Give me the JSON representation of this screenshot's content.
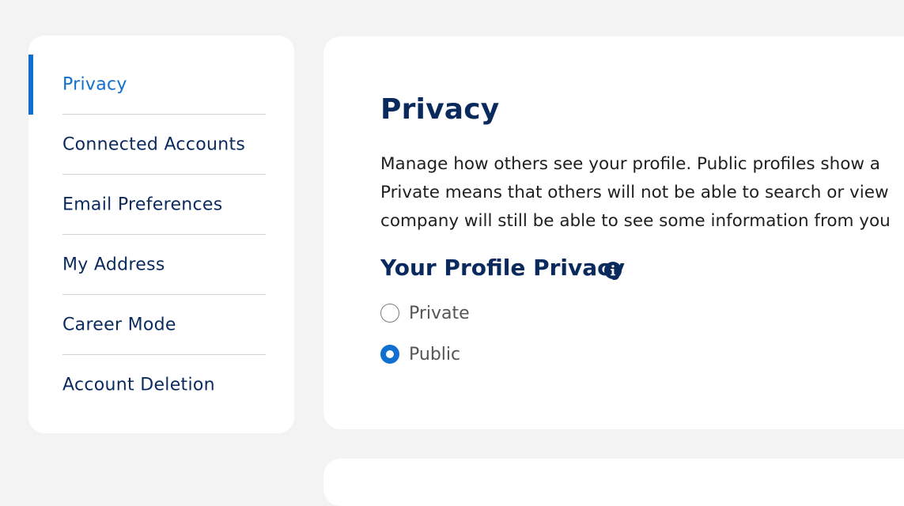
{
  "sidebar": {
    "items": [
      {
        "label": "Privacy",
        "active": true
      },
      {
        "label": "Connected Accounts",
        "active": false
      },
      {
        "label": "Email Preferences",
        "active": false
      },
      {
        "label": "My Address",
        "active": false
      },
      {
        "label": "Career Mode",
        "active": false
      },
      {
        "label": "Account Deletion",
        "active": false
      }
    ]
  },
  "main": {
    "title": "Privacy",
    "description_lines": [
      "Manage how others see your profile. Public profiles show a",
      "Private means that others will not be able to search or view",
      "company will still be able to see some information from you"
    ],
    "section_title": "Your Profile Privacy",
    "info_icon": "info-icon",
    "options": [
      {
        "label": "Private",
        "selected": false
      },
      {
        "label": "Public",
        "selected": true
      }
    ]
  },
  "colors": {
    "accent": "#1170cf",
    "heading": "#0a2a5e",
    "background": "#f3f3f3",
    "card": "#ffffff",
    "divider": "#d3d3d3"
  }
}
